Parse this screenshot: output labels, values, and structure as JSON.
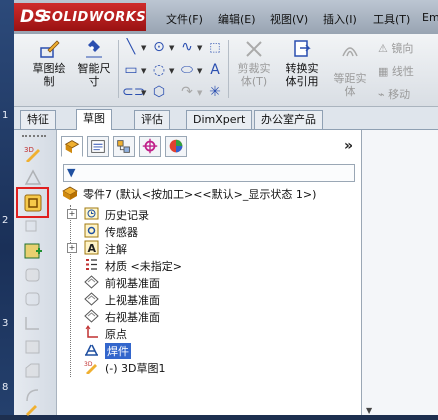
{
  "app": {
    "logo_text": "SOLIDWORKS",
    "logo_mark": "DS"
  },
  "left_edge": {
    "markers": [
      "1",
      "2",
      "3",
      "8"
    ]
  },
  "menu": [
    {
      "label": "文件(F)"
    },
    {
      "label": "编辑(E)"
    },
    {
      "label": "视图(V)"
    },
    {
      "label": "插入(I)"
    },
    {
      "label": "工具(T)"
    },
    {
      "label": "Em"
    }
  ],
  "toolbar": {
    "sketch": "草图绘\n制",
    "smart_dim": "智能尺\n寸",
    "trim": "剪裁实\n体(T)",
    "convert": "转换实\n体引用",
    "offset": "等距实\n体",
    "mirror": "镜向",
    "linear": "线性",
    "move": "移动"
  },
  "cm_tabs": [
    "特征",
    "草图",
    "评估",
    "DimXpert",
    "办公室产品"
  ],
  "active_tab": 1,
  "panel": {
    "expand_label": "»",
    "filter_icon": "filter-icon",
    "root": "零件7 (默认<按加工><<默认>_显示状态 1>)",
    "items": [
      {
        "label": "历史记录",
        "icon": "history-icon",
        "expandable": true
      },
      {
        "label": "传感器",
        "icon": "sensor-icon",
        "expandable": false
      },
      {
        "label": "注解",
        "icon": "annotation-icon",
        "expandable": true
      },
      {
        "label": "材质 <未指定>",
        "icon": "material-icon",
        "expandable": false
      },
      {
        "label": "前视基准面",
        "icon": "plane-icon",
        "expandable": false
      },
      {
        "label": "上视基准面",
        "icon": "plane-icon",
        "expandable": false
      },
      {
        "label": "右视基准面",
        "icon": "plane-icon",
        "expandable": false
      },
      {
        "label": "原点",
        "icon": "origin-icon",
        "expandable": false
      },
      {
        "label": "焊件",
        "icon": "weldment-icon",
        "expandable": false,
        "selected": true
      },
      {
        "label": "(-) 3D草图1",
        "icon": "3d-sketch-icon",
        "expandable": false
      }
    ]
  },
  "colors": {
    "brand": "#c81e1e",
    "highlight_box": "#e02020",
    "selection": "#3366cc"
  }
}
